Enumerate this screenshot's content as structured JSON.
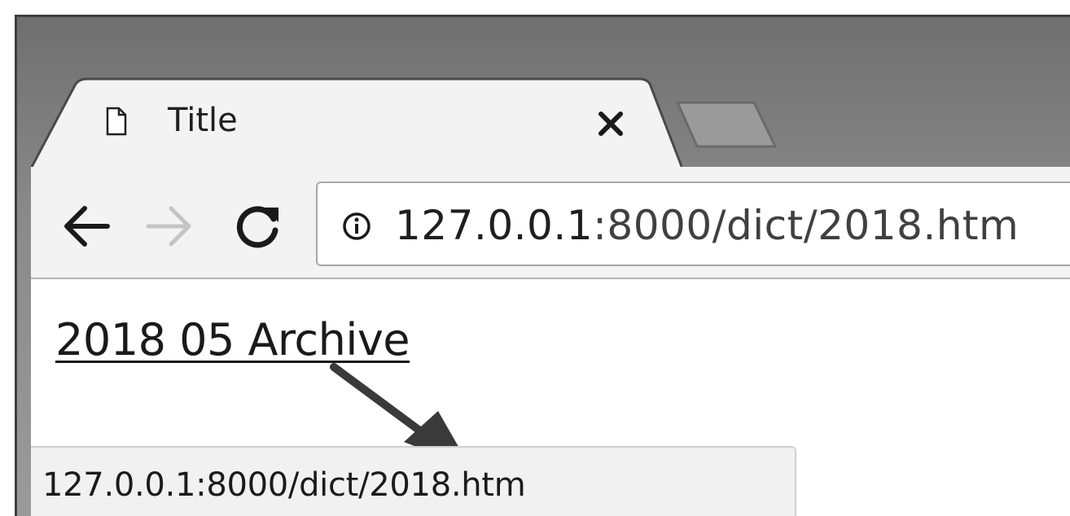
{
  "tab": {
    "title": "Title",
    "icon": "document-icon",
    "close_icon": "close-icon"
  },
  "new_tab": {
    "icon": "new-tab-icon"
  },
  "toolbar": {
    "back_icon": "arrow-left-icon",
    "forward_icon": "arrow-right-icon",
    "reload_icon": "reload-icon",
    "forward_enabled": false
  },
  "omnibox": {
    "info_icon": "info-icon",
    "url_host": "127.0.0.1",
    "url_rest": ":8000/dict/2018.htm"
  },
  "content": {
    "link_text": "2018 05 Archive"
  },
  "status_bar": {
    "url": "127.0.0.1:8000/dict/2018.htm"
  },
  "colors": {
    "frame": "#7a7a7a",
    "toolbar": "#f3f3f3",
    "text": "#1f1f1f",
    "arrow": "#3a3a3a"
  }
}
